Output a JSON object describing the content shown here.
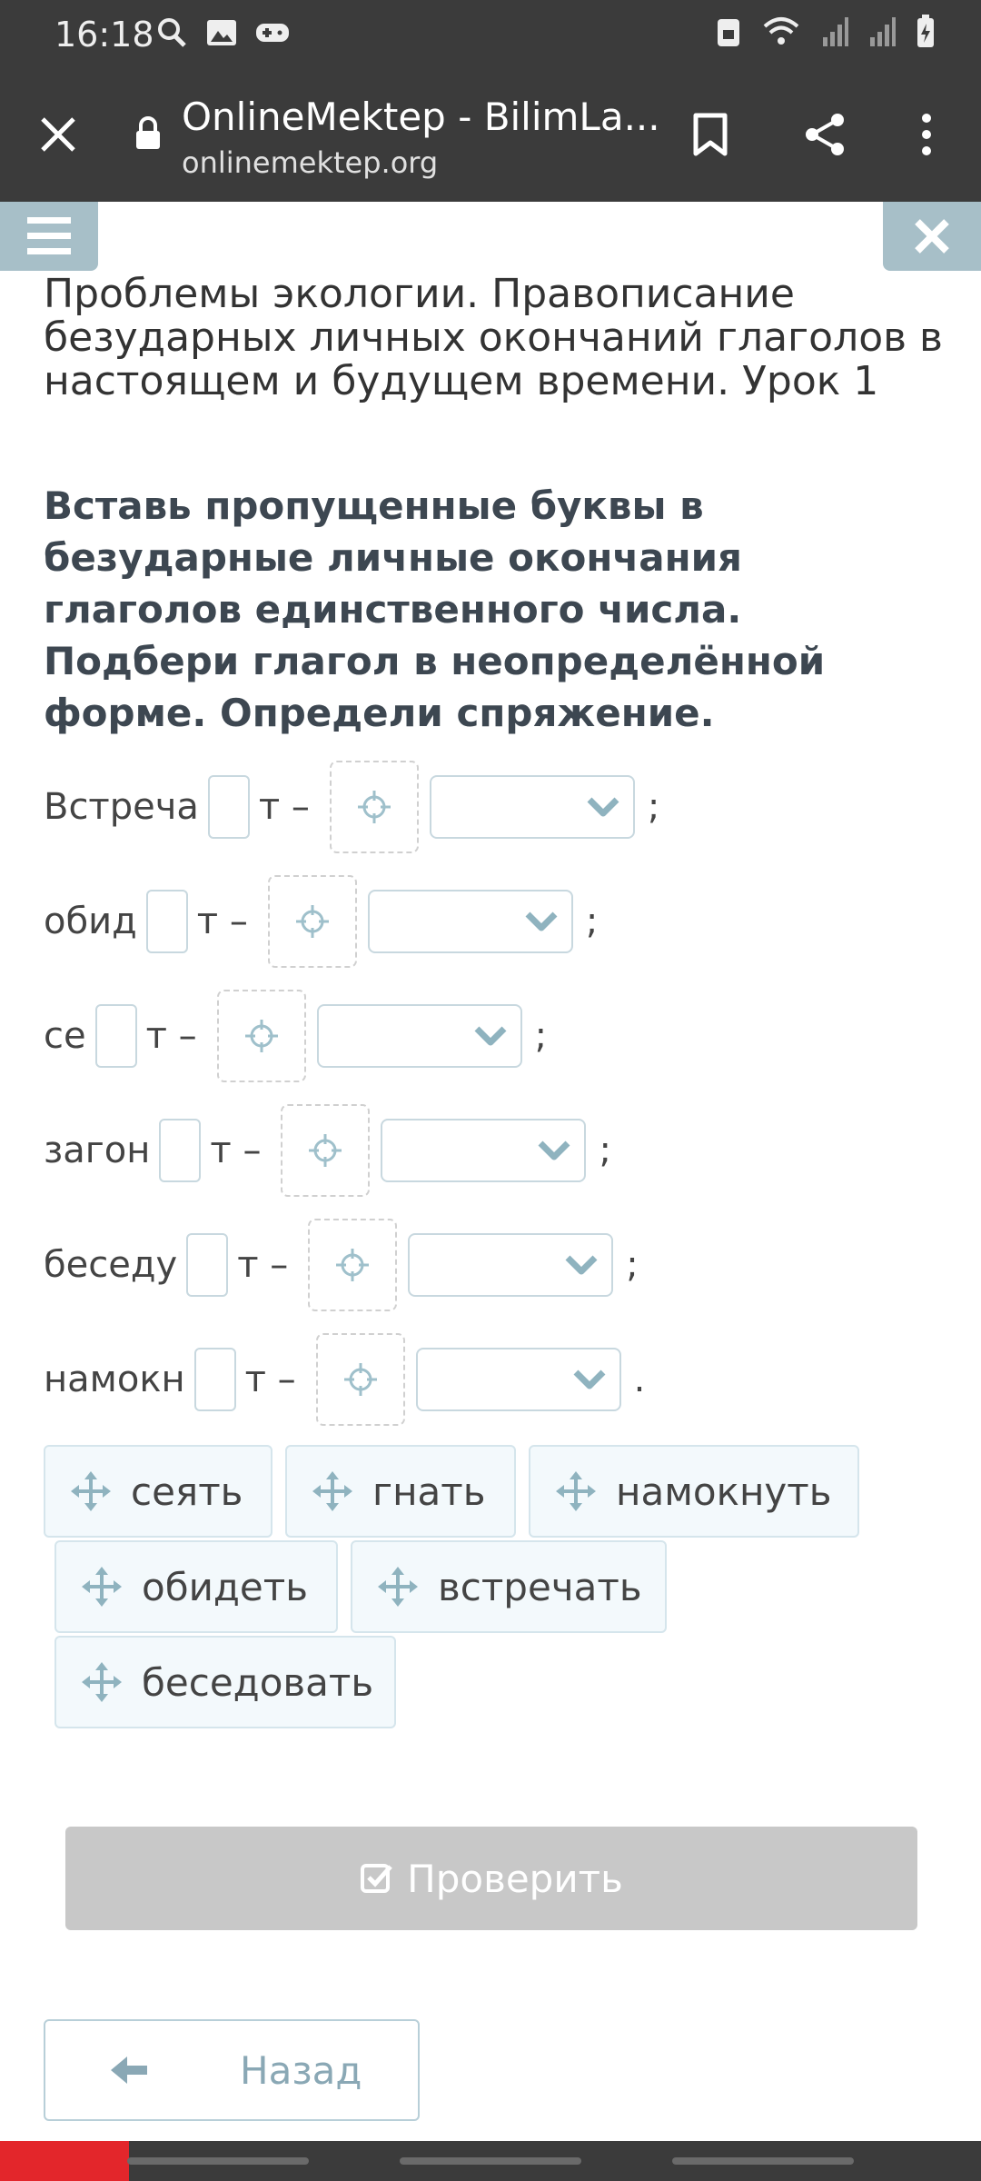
{
  "status_bar": {
    "time": "16:18"
  },
  "browser": {
    "title": "OnlineMektep - BilimLa...",
    "url": "onlinemektep.org"
  },
  "lesson": {
    "title": "Проблемы экологии. Правописание безударных личных окончаний глаголов в настоящем и будущем времени. Урок 1",
    "task": "Вставь пропущенные буквы в безударные личные окончания глаголов единственного числа. Подбери глагол в неопределённой форме. Определи спряжение."
  },
  "exercise_rows": [
    {
      "stem": "Встреча",
      "suffix": "т –",
      "end": ";"
    },
    {
      "stem": "обид",
      "suffix": "т –",
      "end": ";"
    },
    {
      "stem": "се",
      "suffix": "т –",
      "end": ";"
    },
    {
      "stem": "загон",
      "suffix": "т –",
      "end": ";"
    },
    {
      "stem": "беседу",
      "suffix": "т –",
      "end": ";"
    },
    {
      "stem": "намокн",
      "suffix": "т –",
      "end": "."
    }
  ],
  "word_bank": [
    "сеять",
    "гнать",
    "намокнуть",
    "обидеть",
    "встречать",
    "беседовать"
  ],
  "buttons": {
    "check": "Проверить",
    "back": "Назад"
  },
  "colors": {
    "chrome": "#3b3b3b",
    "accent": "#a7bfc8",
    "chip_bg": "#f3f9fc",
    "chevron": "#8fb3bf",
    "check_disabled": "#c8c8c8"
  }
}
